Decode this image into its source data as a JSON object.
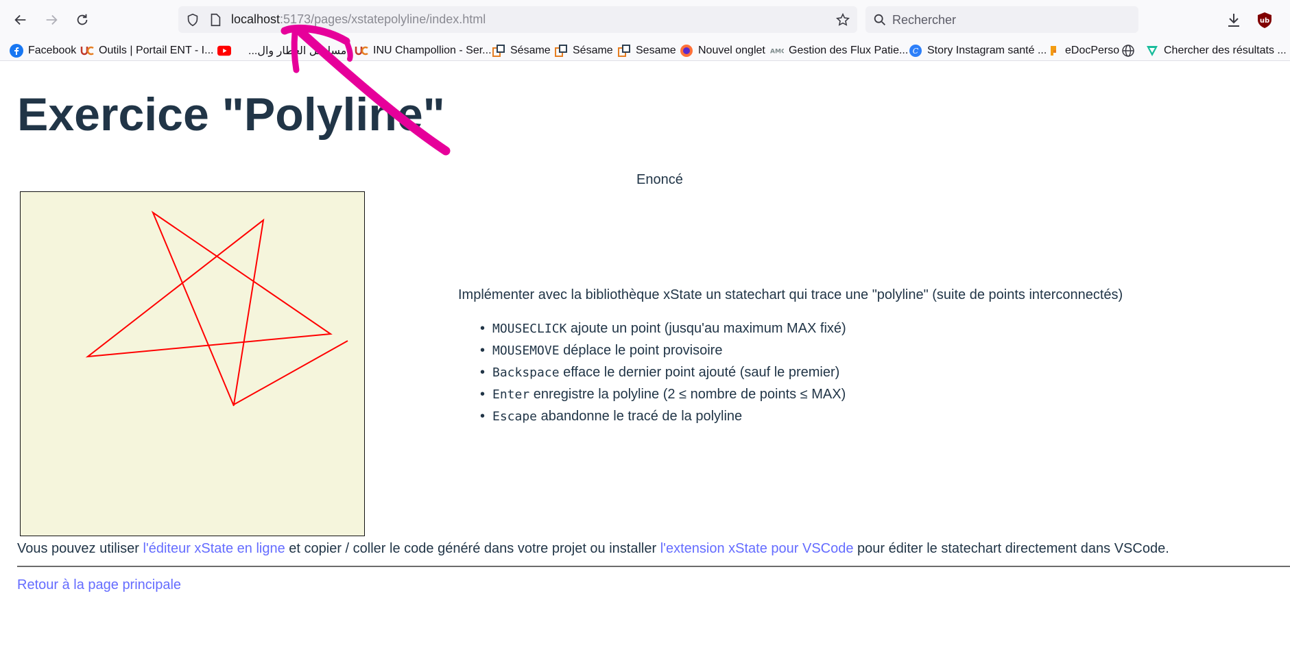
{
  "browser": {
    "url_host": "localhost",
    "url_path": ":5173/pages/xstatepolyline/index.html",
    "search_placeholder": "Rechercher",
    "bookmarks": [
      {
        "label": "Facebook",
        "icon": "facebook-icon"
      },
      {
        "label": "Outils | Portail ENT - I...",
        "icon": "uc-logo-icon"
      },
      {
        "label": "",
        "icon": "youtube-icon"
      },
      {
        "label": "...مسلسل العطار وال",
        "icon": "none"
      },
      {
        "label": "INU Champollion - Ser...",
        "icon": "uc-logo-icon"
      },
      {
        "label": "Sésame",
        "icon": "sesame-icon"
      },
      {
        "label": "Sésame",
        "icon": "sesame-icon"
      },
      {
        "label": "Sesame",
        "icon": "sesame-icon"
      },
      {
        "label": "Nouvel onglet",
        "icon": "firefox-icon"
      },
      {
        "label": "Gestion des Flux Patie...",
        "icon": "amc-icon"
      },
      {
        "label": "Story Instagram santé ...",
        "icon": "canva-icon"
      },
      {
        "label": "eDocPerso",
        "icon": "edocperso-icon"
      },
      {
        "label": "",
        "icon": "globe-icon"
      },
      {
        "label": "Chercher des résultats ...",
        "icon": "checkmark-logo-icon"
      }
    ]
  },
  "page": {
    "title": "Exercice \"Polyline\"",
    "enonce_label": "Enoncé",
    "instructions": "Implémenter avec la bibliothèque xState un statechart qui trace une \"polyline\" (suite de points interconnectés)",
    "rules": [
      {
        "key": "MOUSECLICK",
        "text": " ajoute un point (jusqu'au maximum MAX fixé)"
      },
      {
        "key": "MOUSEMOVE",
        "text": " déplace le point provisoire"
      },
      {
        "key": "Backspace",
        "text": " efface le dernier point ajouté (sauf le premier)"
      },
      {
        "key": "Enter",
        "text": " enregistre la polyline (2 ≤ nombre de points ≤ MAX)"
      },
      {
        "key": "Escape",
        "text": " abandonne le tracé de la polyline"
      }
    ],
    "footer": {
      "prefix": "Vous pouvez utiliser ",
      "link1": "l'éditeur xState en ligne",
      "middle": " et copier / coller le code généré dans votre projet ou installer ",
      "link2": "l'extension xState pour VSCode",
      "suffix": " pour éditer le statechart directement dans VSCode."
    },
    "back_link": "Retour à la page principale"
  },
  "canvas": {
    "background": "#f5f5dc",
    "stroke": "#ff0000"
  },
  "colors": {
    "annotation": "#e6009a",
    "link": "#646cff",
    "text": "#213547"
  }
}
